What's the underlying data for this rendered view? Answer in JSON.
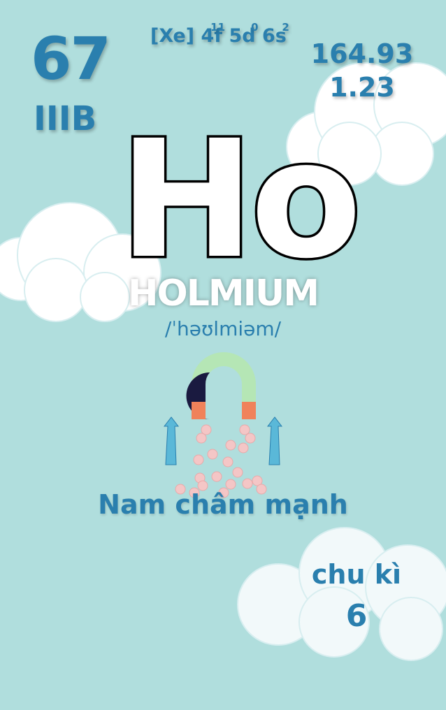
{
  "element": {
    "atomic_number": "67",
    "group": "IIIB",
    "config": {
      "prefix": "[Xe]",
      "parts": [
        {
          "base": "4f",
          "sup": "11"
        },
        {
          "base": "5d",
          "sup": "0"
        },
        {
          "base": "6s",
          "sup": "2"
        }
      ]
    },
    "atomic_mass": "164.93",
    "electronegativity": "1.23",
    "symbol": "Ho",
    "name": "HOLMIUM",
    "ipa": "/ˈhəʊlmiəm/",
    "caption": "Nam châm mạnh",
    "period_label": "chu kì",
    "period_value": "6"
  },
  "colors": {
    "background": "#b0dedd",
    "text_blue": "#2a7fae",
    "cloud": "#ffffff",
    "magnet_green": "#b5e6b5",
    "magnet_red": "#f0825a",
    "arrow_blue": "#5ab8d8",
    "ball_pink": "#f4c6c6"
  }
}
